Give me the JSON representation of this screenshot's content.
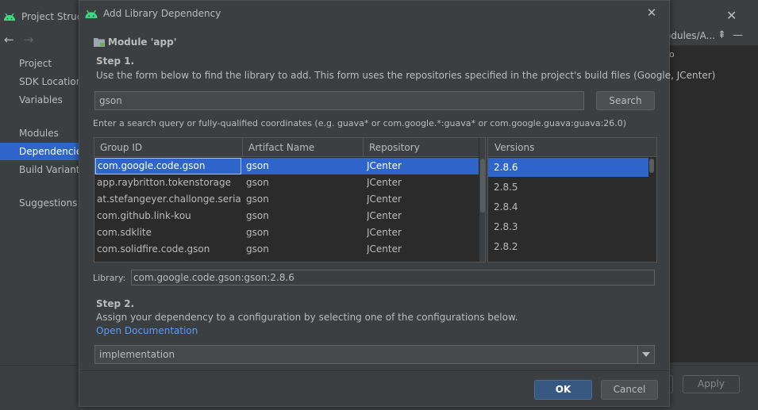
{
  "background_window": {
    "title": "Project Structu",
    "nav_back": "←",
    "nav_forward": "→",
    "sidebar": {
      "items": [
        {
          "label": "Project"
        },
        {
          "label": "SDK Location"
        },
        {
          "label": "Variables"
        },
        {
          "label": "Modules"
        },
        {
          "label": "Dependencies"
        },
        {
          "label": "Build Variants"
        },
        {
          "label": "Suggestions"
        }
      ],
      "selected": "Dependencies"
    },
    "breadcrumb": "odules/A...",
    "right_glyph": "o",
    "apply_label": "Apply"
  },
  "dialog": {
    "title": "Add Library Dependency",
    "module_label": "Module 'app'",
    "step1": {
      "title": "Step 1.",
      "description": "Use the form below to find the library to add. This form uses the repositories specified in the project's build files (Google, JCenter)",
      "search_value": "gson",
      "search_button": "Search",
      "hint": "Enter a search query or fully-qualified coordinates (e.g. guava* or com.google.*:guava* or com.google.guava:guava:26.0)"
    },
    "results": {
      "columns": [
        "Group ID",
        "Artifact Name",
        "Repository"
      ],
      "rows": [
        {
          "group": "com.google.code.gson",
          "artifact": "gson",
          "repo": "JCenter"
        },
        {
          "group": "app.raybritton.tokenstorage",
          "artifact": "gson",
          "repo": "JCenter"
        },
        {
          "group": "at.stefangeyer.challonge.serializer",
          "artifact": "gson",
          "repo": "JCenter"
        },
        {
          "group": "com.github.link-kou",
          "artifact": "gson",
          "repo": "JCenter"
        },
        {
          "group": "com.sdklite",
          "artifact": "gson",
          "repo": "JCenter"
        },
        {
          "group": "com.solidfire.code.gson",
          "artifact": "gson",
          "repo": "JCenter"
        }
      ],
      "selected_row": 0
    },
    "versions": {
      "header": "Versions",
      "items": [
        "2.8.6",
        "2.8.5",
        "2.8.4",
        "2.8.3",
        "2.8.2"
      ],
      "selected": "2.8.6"
    },
    "library": {
      "label": "Library:",
      "value": "com.google.code.gson:gson:2.8.6"
    },
    "step2": {
      "title": "Step 2.",
      "description": "Assign your dependency to a configuration by selecting one of the configurations below.",
      "doc_link": "Open Documentation",
      "configuration": "implementation"
    },
    "ok_label": "OK",
    "cancel_label": "Cancel"
  },
  "colors": {
    "selection": "#2f65ca",
    "link": "#589df6",
    "android_green": "#3ddc84",
    "ok_button": "#365880"
  }
}
